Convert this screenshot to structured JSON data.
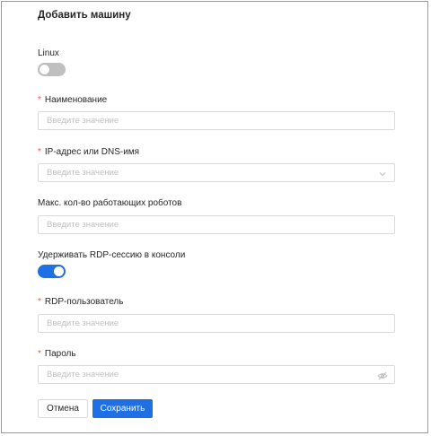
{
  "dialog": {
    "title": "Добавить машину"
  },
  "fields": {
    "linux": {
      "label": "Linux",
      "enabled": false
    },
    "name": {
      "required_mark": "*",
      "label": "Наименование",
      "placeholder": "Введите значение"
    },
    "address": {
      "required_mark": "*",
      "label": "IP-адрес или DNS-имя",
      "placeholder": "Введите значение",
      "suffix_icon": "chevron-down-icon"
    },
    "max_robots": {
      "label": "Макс. кол-во работающих роботов",
      "placeholder": "Введите значение"
    },
    "keep_rdp": {
      "label": "Удерживать RDP-сессию в консоли",
      "enabled": true
    },
    "rdp_user": {
      "required_mark": "*",
      "label": "RDP-пользователь",
      "placeholder": "Введите значение"
    },
    "password": {
      "required_mark": "*",
      "label": "Пароль",
      "placeholder": "Введите значение",
      "suffix_icon": "eye-invisible-icon"
    }
  },
  "actions": {
    "cancel_label": "Отмена",
    "save_label": "Сохранить"
  },
  "colors": {
    "primary": "#1f6fe5",
    "required": "#ff4d4f",
    "toggle_off": "#bfbfbf",
    "border": "#d9d9d9",
    "placeholder": "#bfbfbf"
  }
}
